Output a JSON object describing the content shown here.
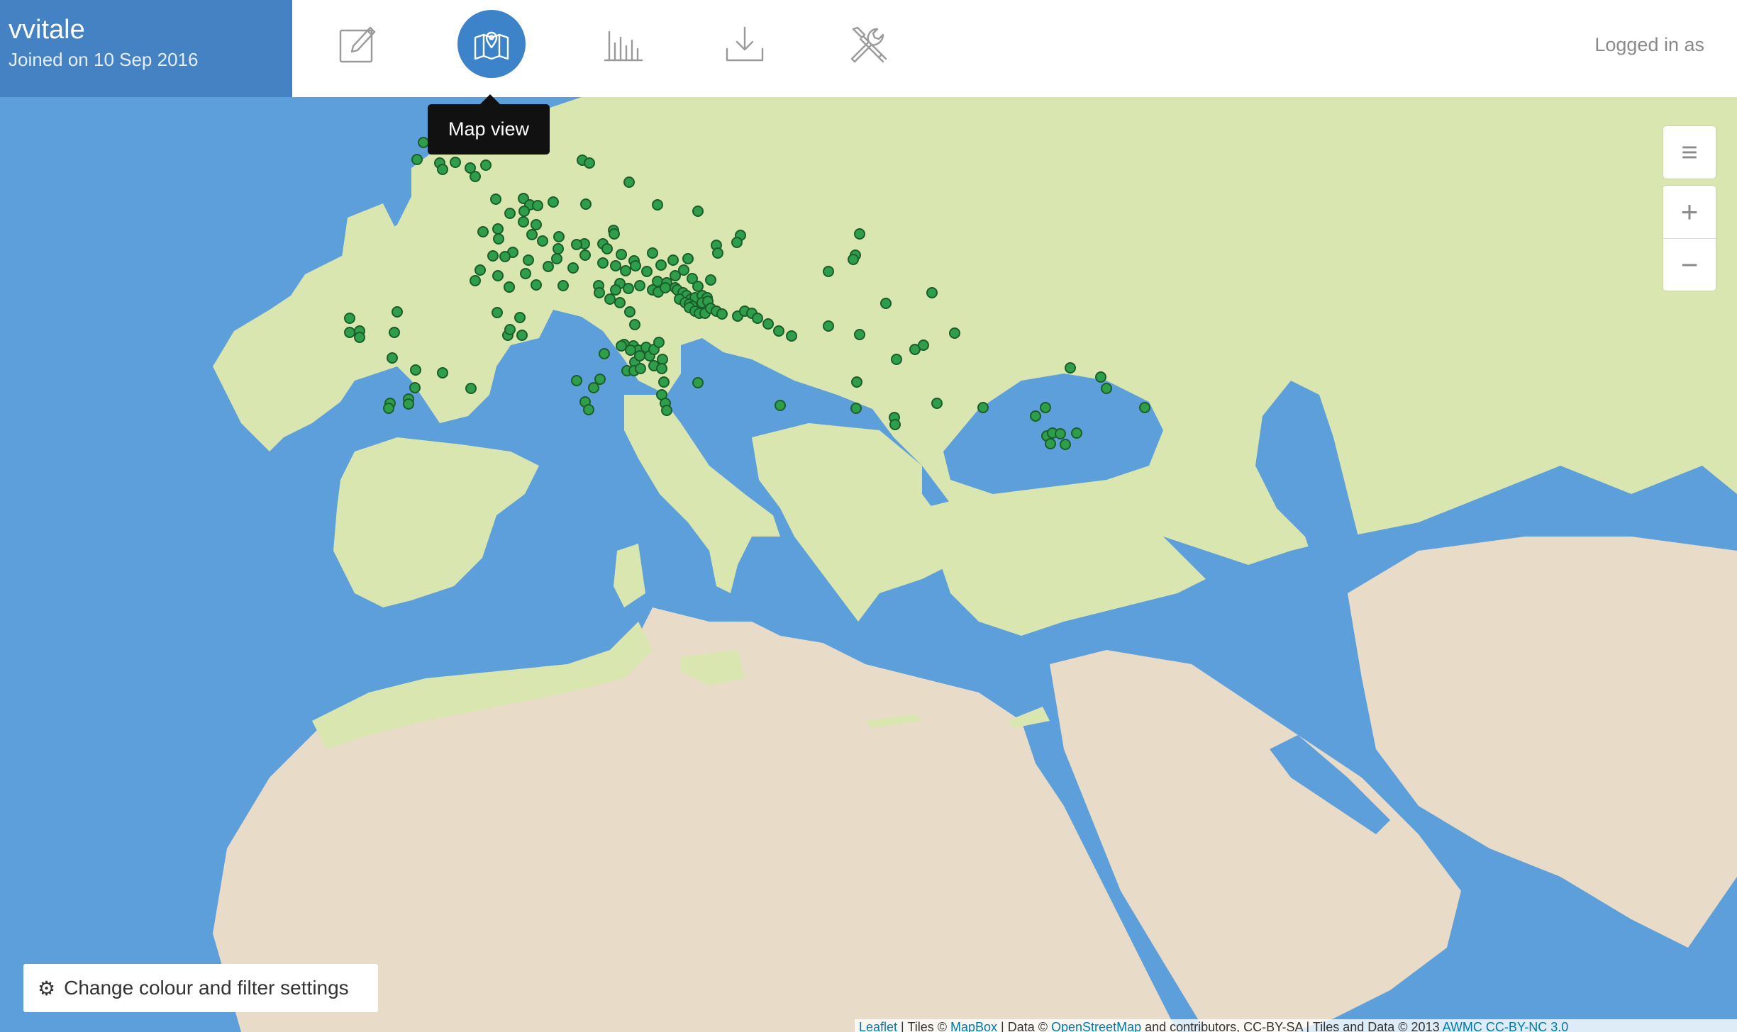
{
  "user": {
    "name": "vvitale",
    "joined": "Joined on 10 Sep 2016"
  },
  "nav": {
    "items": [
      {
        "icon": "edit-icon",
        "label": "Edit"
      },
      {
        "icon": "map-icon",
        "label": "Map view",
        "active": true
      },
      {
        "icon": "chart-icon",
        "label": "Statistics"
      },
      {
        "icon": "download-icon",
        "label": "Download"
      },
      {
        "icon": "tools-icon",
        "label": "Tools"
      }
    ],
    "tooltip": "Map view"
  },
  "header": {
    "logged_in": "Logged in as"
  },
  "map": {
    "layers_icon": "≡",
    "zoom_in": "+",
    "zoom_out": "−",
    "filter_button": "Change colour and filter settings",
    "marker_color": "#2e9e4a",
    "attribution": {
      "leaflet": "Leaflet",
      "tiles_prefix": " | Tiles © ",
      "mapbox": "MapBox",
      "data_prefix": " | Data © ",
      "osm": "OpenStreetMap",
      "data_suffix": " and contributors, CC-BY-SA | Tiles and Data © 2013 ",
      "awmc": "AWMC CC-BY-NC 3.0"
    }
  },
  "colors": {
    "sea": "#5d9fdb",
    "land_green": "#d9e6b0",
    "desert": "#e8dcc8",
    "accent": "#3c83c9"
  }
}
